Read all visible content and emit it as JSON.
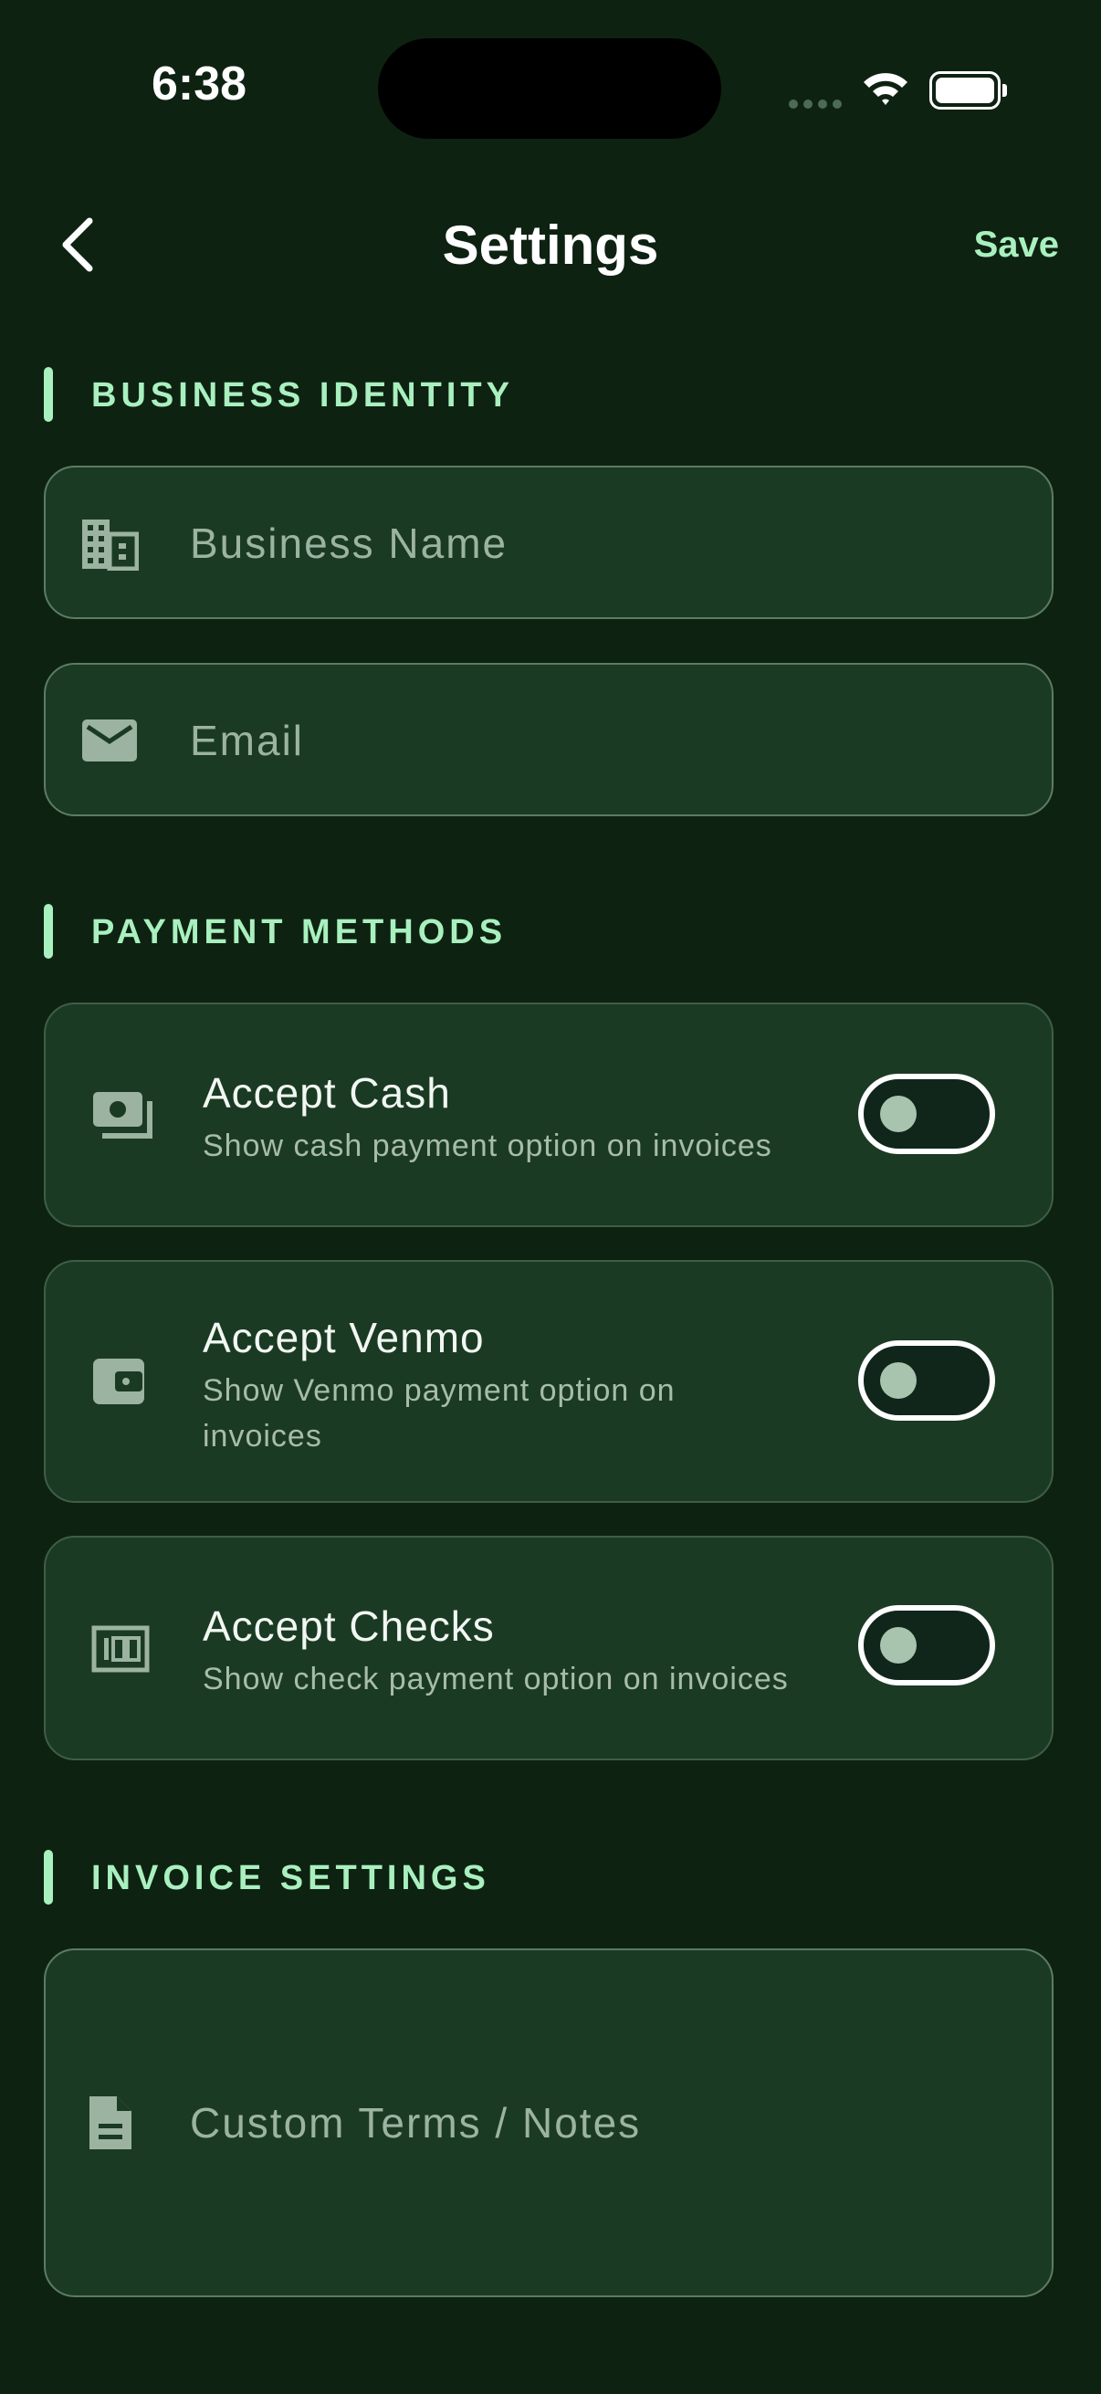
{
  "status_bar": {
    "time": "6:38"
  },
  "nav": {
    "title": "Settings",
    "save_label": "Save"
  },
  "sections": {
    "business": {
      "label": "BUSINESS IDENTITY"
    },
    "payment": {
      "label": "PAYMENT METHODS"
    },
    "invoice": {
      "label": "INVOICE SETTINGS"
    }
  },
  "fields": {
    "business_name": {
      "placeholder": "Business Name",
      "value": "",
      "icon": "building-icon"
    },
    "email": {
      "placeholder": "Email",
      "value": "",
      "icon": "mail-icon"
    },
    "custom_terms": {
      "placeholder": "Custom Terms / Notes",
      "value": "",
      "icon": "document-icon"
    }
  },
  "payment_methods": [
    {
      "title": "Accept Cash",
      "description": "Show cash payment option on invoices",
      "enabled": false,
      "icon": "cash-icon"
    },
    {
      "title": "Accept Venmo",
      "description": "Show Venmo payment option on invoices",
      "enabled": false,
      "icon": "wallet-icon"
    },
    {
      "title": "Accept Checks",
      "description": "Show check payment option on invoices",
      "enabled": false,
      "icon": "check-icon"
    }
  ],
  "colors": {
    "background": "#0e2212",
    "card": "#1b3a23",
    "accent": "#a9f0bf",
    "muted_text": "#9bb3a0"
  }
}
